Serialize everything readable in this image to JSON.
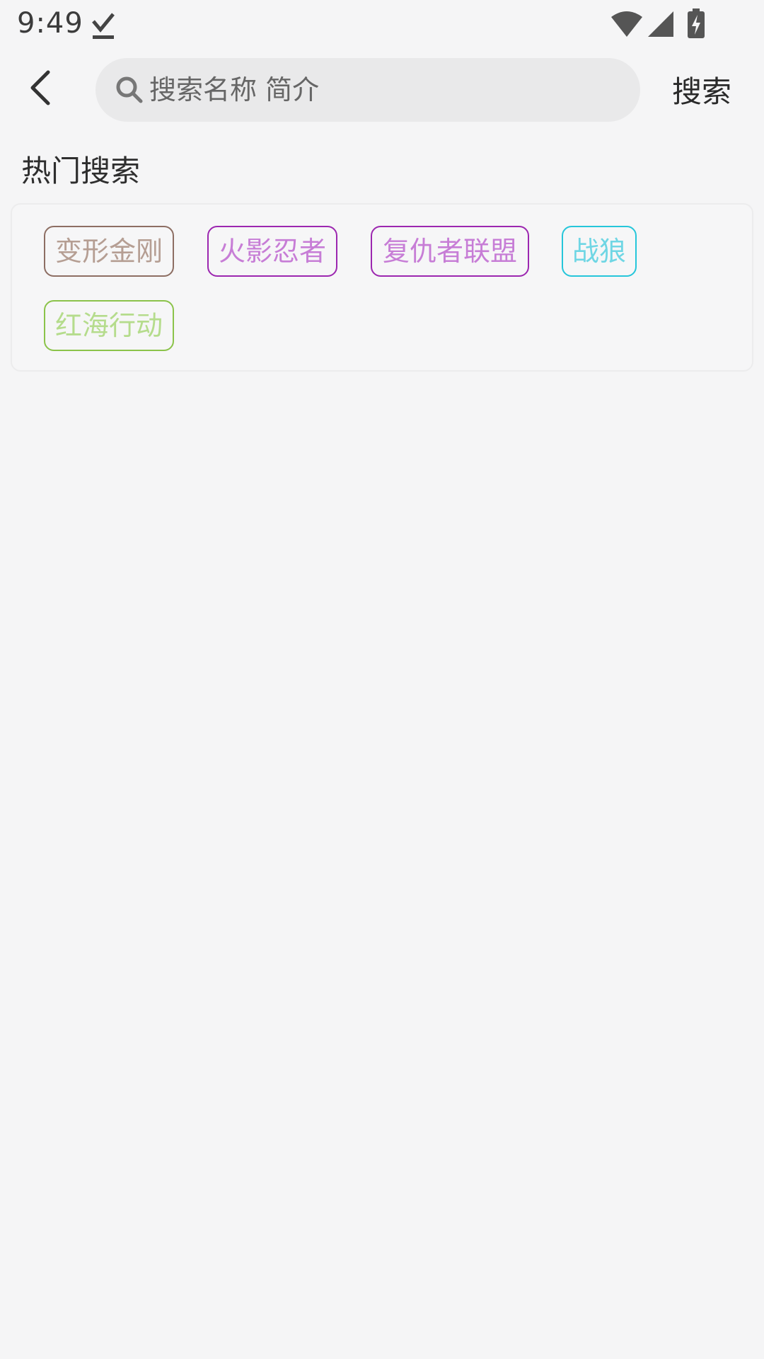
{
  "status_bar": {
    "time": "9:49",
    "icons": [
      "download-done-icon",
      "wifi-icon",
      "signal-icon",
      "battery-charging-icon"
    ]
  },
  "header": {
    "back_icon": "chevron-left-icon",
    "search_icon": "search-icon",
    "search_placeholder": "搜索名称 简介",
    "search_value": "",
    "search_button_label": "搜索"
  },
  "hot_search": {
    "title": "热门搜索",
    "tags": [
      {
        "label": "变形金刚",
        "border_color": "#8d6e63",
        "text_color": "#b59e93"
      },
      {
        "label": "火影忍者",
        "border_color": "#9c27b0",
        "text_color": "#c77dd6"
      },
      {
        "label": "复仇者联盟",
        "border_color": "#9c27b0",
        "text_color": "#c77dd6"
      },
      {
        "label": "战狼",
        "border_color": "#26c6da",
        "text_color": "#6fd6e4"
      },
      {
        "label": "红海行动",
        "border_color": "#8bc34a",
        "text_color": "#b5dc8c"
      }
    ]
  }
}
